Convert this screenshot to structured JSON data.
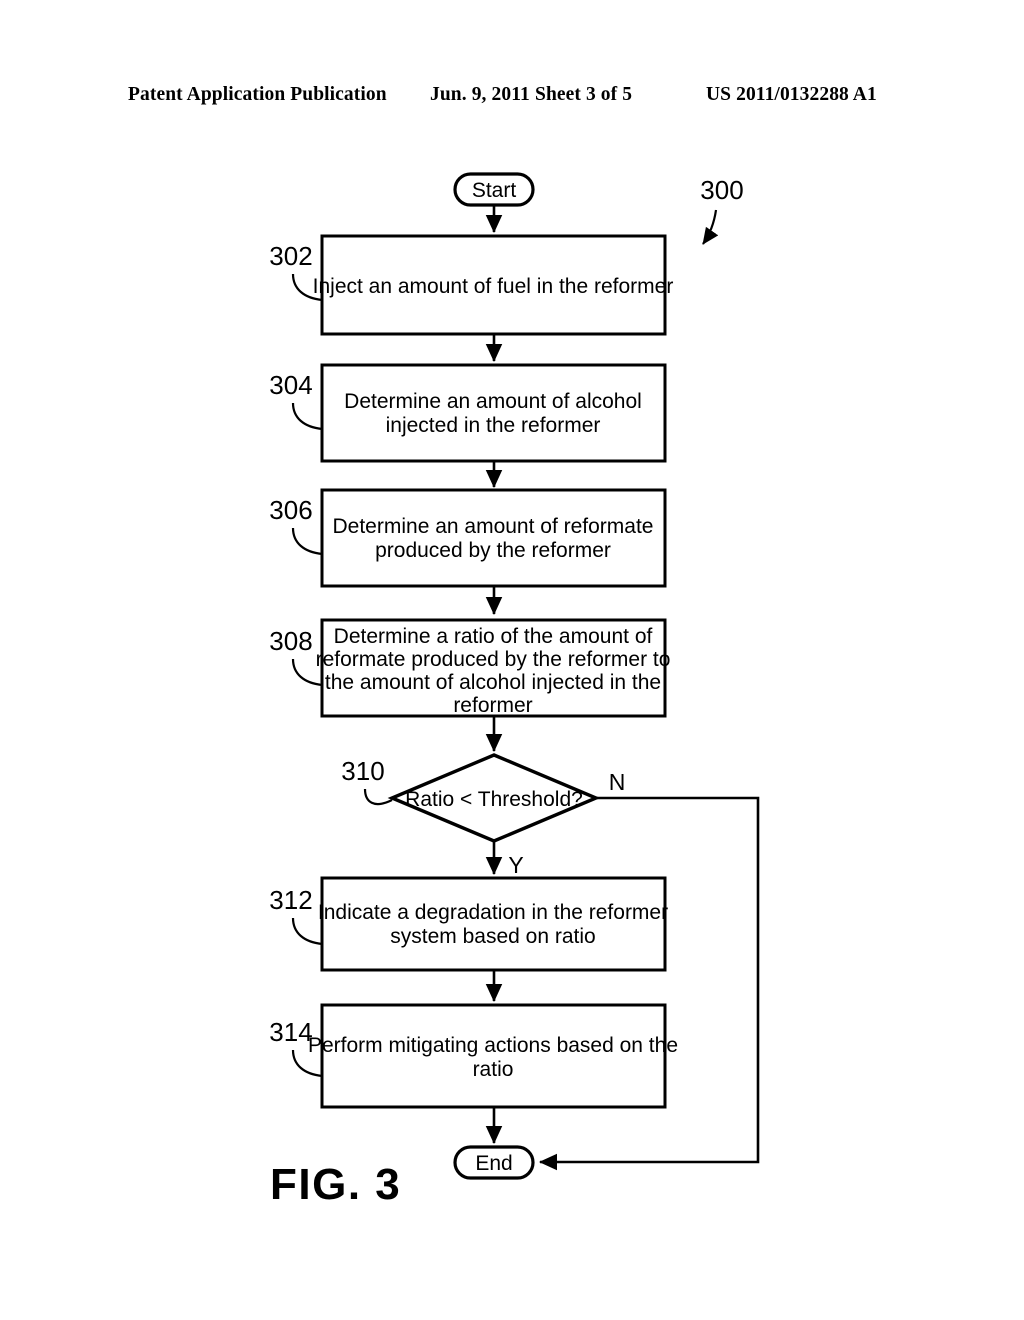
{
  "header": {
    "publication": "Patent Application Publication",
    "date": "Jun. 9, 2011",
    "sheet": "Sheet 3 of 5",
    "patent_number": "US 2011/0132288 A1"
  },
  "figure": {
    "caption": "FIG. 3",
    "diagram_ref": "300"
  },
  "chart_data": {
    "type": "diagram",
    "title": "FIG. 3",
    "diagram_kind": "flowchart",
    "reference_numeral": "300",
    "nodes": [
      {
        "id": "start",
        "kind": "terminal",
        "label": "Start",
        "ref": ""
      },
      {
        "id": "n302",
        "kind": "process",
        "label": "Inject an amount of fuel in the reformer",
        "ref": "302"
      },
      {
        "id": "n304",
        "kind": "process",
        "label": "Determine an amount of alcohol injected in the reformer",
        "ref": "304"
      },
      {
        "id": "n306",
        "kind": "process",
        "label": "Determine an amount of reformate produced by the reformer",
        "ref": "306"
      },
      {
        "id": "n308",
        "kind": "process",
        "label": "Determine a ratio of the amount of reformate produced by the reformer to the amount of alcohol injected in the reformer",
        "ref": "308"
      },
      {
        "id": "n310",
        "kind": "decision",
        "label": "Ratio < Threshold?",
        "ref": "310"
      },
      {
        "id": "n312",
        "kind": "process",
        "label": "Indicate a degradation in the reformer system based on ratio",
        "ref": "312"
      },
      {
        "id": "n314",
        "kind": "process",
        "label": "Perform mitigating actions based on the ratio",
        "ref": "314"
      },
      {
        "id": "end",
        "kind": "terminal",
        "label": "End",
        "ref": ""
      }
    ],
    "edges": [
      {
        "from": "start",
        "to": "n302",
        "label": ""
      },
      {
        "from": "n302",
        "to": "n304",
        "label": ""
      },
      {
        "from": "n304",
        "to": "n306",
        "label": ""
      },
      {
        "from": "n306",
        "to": "n308",
        "label": ""
      },
      {
        "from": "n308",
        "to": "n310",
        "label": ""
      },
      {
        "from": "n310",
        "to": "n312",
        "label": "Y"
      },
      {
        "from": "n310",
        "to": "end",
        "label": "N"
      },
      {
        "from": "n312",
        "to": "n314",
        "label": ""
      },
      {
        "from": "n314",
        "to": "end",
        "label": ""
      }
    ]
  },
  "nodes": {
    "start": {
      "label": "Start"
    },
    "n302": {
      "ref": "302",
      "line1": "Inject an amount of fuel in the reformer"
    },
    "n304": {
      "ref": "304",
      "line1": "Determine an amount of alcohol",
      "line2": "injected in the reformer"
    },
    "n306": {
      "ref": "306",
      "line1": "Determine an amount of reformate",
      "line2": "produced by the reformer"
    },
    "n308": {
      "ref": "308",
      "line1": "Determine a ratio of the amount of",
      "line2": "reformate produced by the reformer to",
      "line3": "the amount of alcohol injected in the",
      "line4": "reformer"
    },
    "n310": {
      "ref": "310",
      "label": "Ratio < Threshold?",
      "yes": "Y",
      "no": "N"
    },
    "n312": {
      "ref": "312",
      "line1": "Indicate a degradation in the reformer",
      "line2": "system based on ratio"
    },
    "n314": {
      "ref": "314",
      "line1": "Perform mitigating actions based on the",
      "line2": "ratio"
    },
    "end": {
      "label": "End"
    }
  },
  "colors": {
    "ink": "#000000",
    "paper": "#ffffff"
  }
}
